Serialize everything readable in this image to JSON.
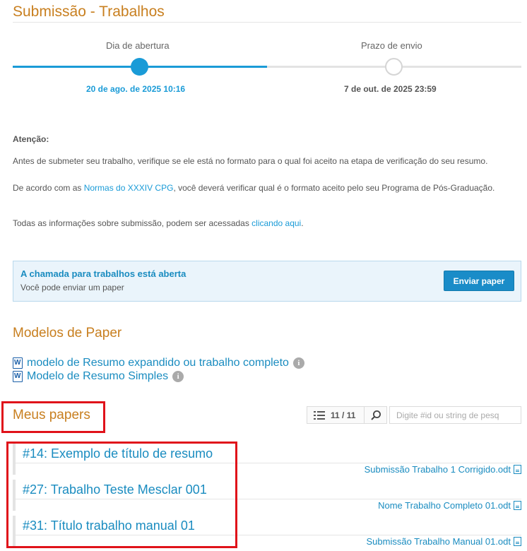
{
  "page": {
    "title": "Submissão - Trabalhos"
  },
  "timeline": {
    "open_label": "Dia de abertura",
    "open_date": "20 de ago. de 2025 10:16",
    "close_label": "Prazo de envio",
    "close_date": "7 de out. de 2025 23:59"
  },
  "notice": {
    "title": "Atenção:",
    "p1": "Antes de submeter seu trabalho, verifique se ele está no formato para o qual foi aceito na etapa de verificação do seu resumo.",
    "p2_before": "De acordo com as ",
    "p2_link": "Normas do XXXIV CPG",
    "p2_after": ", você deverá verificar qual é o formato aceito pelo seu Programa de Pós-Graduação.",
    "p3_before": "Todas as informações sobre submissão, podem ser acessadas ",
    "p3_link": "clicando aqui",
    "p3_after": "."
  },
  "call": {
    "title": "A chamada para trabalhos está aberta",
    "subtitle": "Você pode enviar um paper",
    "button": "Enviar paper"
  },
  "models": {
    "heading": "Modelos de Paper",
    "items": [
      {
        "label": "modelo de Resumo expandido ou trabalho completo",
        "icon": "word-doc-icon"
      },
      {
        "label": "Modelo de Resumo Simples",
        "icon": "word-doc-icon"
      }
    ]
  },
  "my_papers": {
    "heading": "Meus papers",
    "count": "11 / 11",
    "search_placeholder": "Digite #id ou string de pesq",
    "items": [
      {
        "title": "#14: Exemplo de título de resumo",
        "file": "Submissão Trabalho 1 Corrigido.odt"
      },
      {
        "title": "#27: Trabalho Teste Mesclar 001",
        "file": "Nome Trabalho Completo 01.odt"
      },
      {
        "title": "#31: Título trabalho manual 01",
        "file": "Submissão Trabalho Manual 01.odt"
      }
    ]
  },
  "colors": {
    "accent": "#1a9bd7",
    "heading": "#c87f1f",
    "highlight": "#e0121a"
  }
}
